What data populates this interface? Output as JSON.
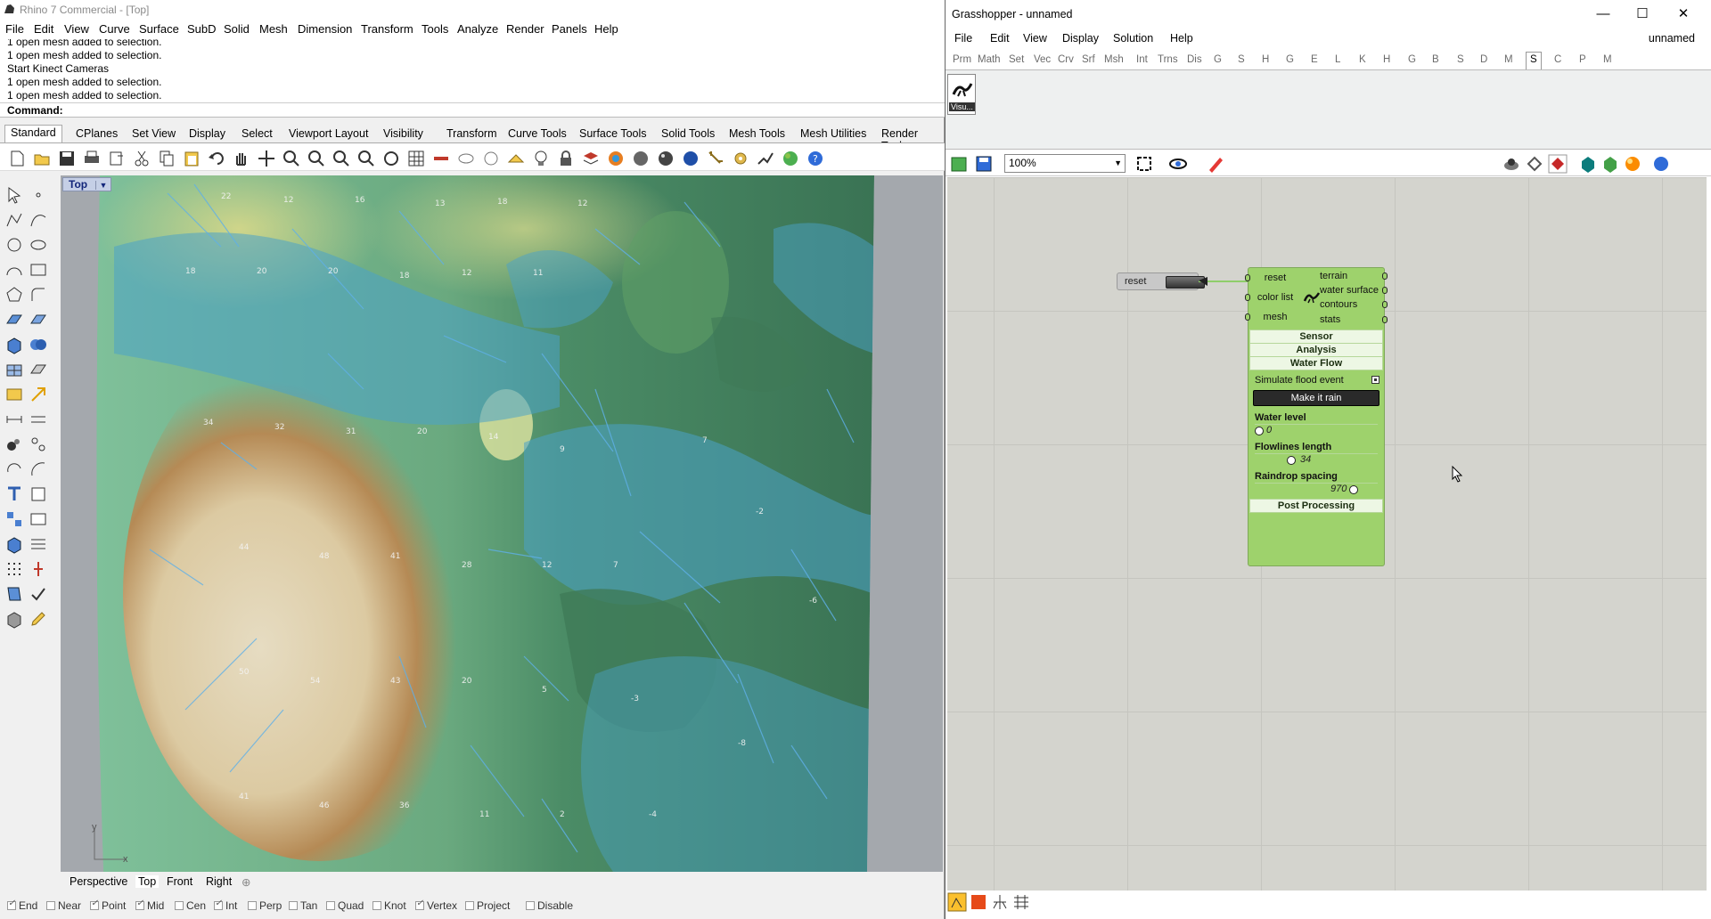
{
  "rhino": {
    "title": "Rhino 7 Commercial - [Top]",
    "menu": [
      "File",
      "Edit",
      "View",
      "Curve",
      "Surface",
      "SubD",
      "Solid",
      "Mesh",
      "Dimension",
      "Transform",
      "Tools",
      "Analyze",
      "Render",
      "Panels",
      "Help"
    ],
    "history": [
      "1 open mesh added to selection.",
      "1 open mesh added to selection.",
      "Start Kinect Cameras",
      "1 open mesh added to selection.",
      "1 open mesh added to selection."
    ],
    "command_label": "Command:",
    "toolbar_tabs": [
      "Standard",
      "CPlanes",
      "Set View",
      "Display",
      "Select",
      "Viewport Layout",
      "Visibility",
      "Transform",
      "Curve Tools",
      "Surface Tools",
      "Solid Tools",
      "Mesh Tools",
      "Mesh Utilities",
      "Render Tools"
    ],
    "active_toolbar_tab": "Standard",
    "viewport_name": "Top",
    "axis_labels": {
      "x": "x",
      "y": "y"
    },
    "viewport_tabs": [
      "Perspective",
      "Top",
      "Front",
      "Right"
    ],
    "active_viewport_tab": "Top",
    "osnaps": [
      {
        "label": "End",
        "checked": true
      },
      {
        "label": "Near",
        "checked": false
      },
      {
        "label": "Point",
        "checked": true
      },
      {
        "label": "Mid",
        "checked": true
      },
      {
        "label": "Cen",
        "checked": false
      },
      {
        "label": "Int",
        "checked": true
      },
      {
        "label": "Perp",
        "checked": false
      },
      {
        "label": "Tan",
        "checked": false
      },
      {
        "label": "Quad",
        "checked": false
      },
      {
        "label": "Knot",
        "checked": false
      },
      {
        "label": "Vertex",
        "checked": true
      },
      {
        "label": "Project",
        "checked": false
      },
      {
        "label": "Disable",
        "checked": false
      }
    ]
  },
  "grasshopper": {
    "title": "Grasshopper - unnamed",
    "menu": [
      "File",
      "Edit",
      "View",
      "Display",
      "Solution",
      "Help"
    ],
    "document_name": "unnamed",
    "category_tabs": [
      "Prm",
      "Math",
      "Set",
      "Vec",
      "Crv",
      "Srf",
      "Msh",
      "Int",
      "Trns",
      "Dis",
      "G",
      "S",
      "H",
      "G",
      "E",
      "L",
      "K",
      "H",
      "G",
      "B",
      "S",
      "D",
      "M",
      "S",
      "C",
      "P",
      "M"
    ],
    "active_category_index": 23,
    "ribbon_item_label": "Visu...",
    "zoom": "100%",
    "reset_param_label": "reset",
    "component": {
      "inputs": [
        "reset",
        "color list",
        "mesh"
      ],
      "outputs": [
        "terrain",
        "water surface",
        "contours",
        "stats"
      ],
      "sections": [
        "Sensor",
        "Analysis",
        "Water Flow"
      ],
      "simulate_flood_label": "Simulate flood event",
      "rain_button_label": "Make it rain",
      "water_level_label": "Water level",
      "water_level_value": "0",
      "flowlines_label": "Flowlines length",
      "flowlines_value": "34",
      "raindrop_label": "Raindrop spacing",
      "raindrop_value": "970",
      "post_processing_label": "Post Processing"
    },
    "colors": {
      "component_fill": "#9ed26c",
      "canvas": "#d4d4ce"
    }
  }
}
